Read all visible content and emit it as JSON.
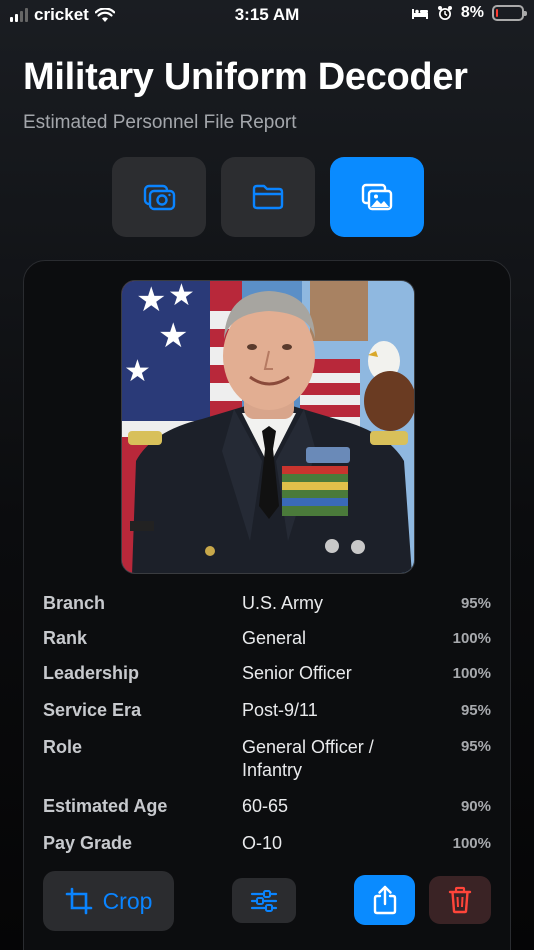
{
  "status_bar": {
    "carrier": "cricket",
    "time": "3:15 AM",
    "battery_percent": "8%",
    "battery_level": 0.08,
    "battery_color": "#ff3b30",
    "icons": [
      "signal-icon",
      "wifi-icon",
      "bed-icon",
      "alarm-icon",
      "battery-icon"
    ]
  },
  "header": {
    "title": "Military Uniform Decoder",
    "subtitle": "Estimated Personnel File Report"
  },
  "source_buttons": [
    {
      "icon": "camera-icon",
      "active": false
    },
    {
      "icon": "folder-icon",
      "active": false
    },
    {
      "icon": "photo-gallery-icon",
      "active": true
    }
  ],
  "accent_color": "#0a84ff",
  "attributes": [
    {
      "label": "Branch",
      "value": "U.S. Army",
      "confidence": "95%"
    },
    {
      "label": "Rank",
      "value": "General",
      "confidence": "100%"
    },
    {
      "label": "Leadership",
      "value": "Senior Officer",
      "confidence": "100%"
    },
    {
      "label": "Service Era",
      "value": "Post-9/11",
      "confidence": "95%"
    },
    {
      "label": "Role",
      "value": "General Officer / Infantry",
      "confidence": "95%"
    },
    {
      "label": "Estimated Age",
      "value": "60-65",
      "confidence": "90%"
    },
    {
      "label": "Pay Grade",
      "value": "O-10",
      "confidence": "100%"
    }
  ],
  "actions": {
    "crop_label": "Crop",
    "adjust_icon": "sliders-icon",
    "share_icon": "share-icon",
    "delete_icon": "trash-icon",
    "delete_color": "#ff453a"
  }
}
